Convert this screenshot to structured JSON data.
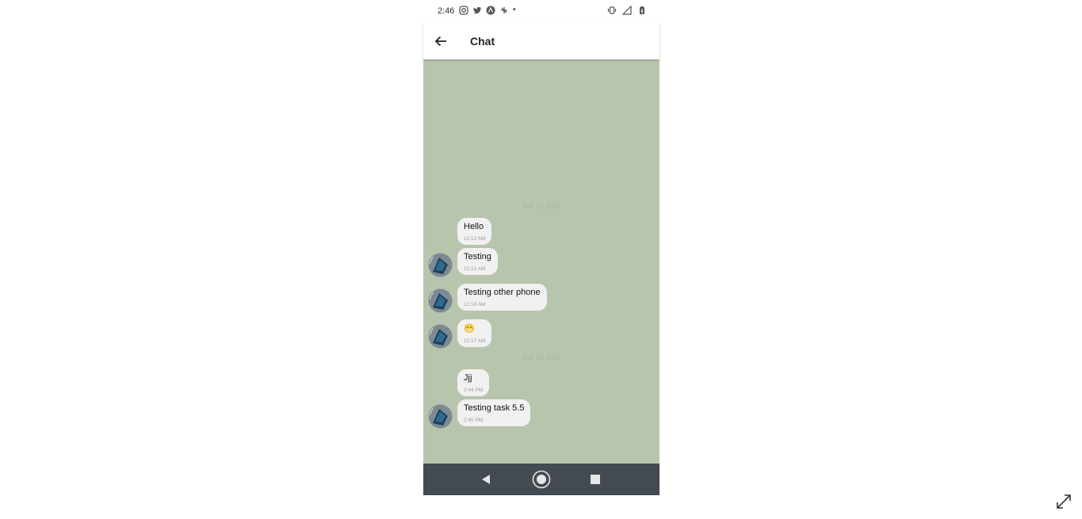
{
  "status_bar": {
    "time": "2:46",
    "left_icons": [
      "instagram-icon",
      "twitter-icon",
      "app-icon",
      "network-icon",
      "more-dot-icon"
    ],
    "right_icons": [
      "vibrate-icon",
      "signal-icon",
      "battery-icon"
    ]
  },
  "app_bar": {
    "title": "Chat",
    "back_icon": "arrow-left-icon"
  },
  "chat": {
    "background_color": "#b8c5ad",
    "date_separators": [
      "Feb 17, 2021",
      "Feb 18, 2021"
    ],
    "messages": [
      {
        "text": "Hello",
        "time": "12:12 AM",
        "avatar": false
      },
      {
        "text": "Testing",
        "time": "12:13 AM",
        "avatar": true
      },
      {
        "text": "Testing other phone",
        "time": "12:16 AM",
        "avatar": true
      },
      {
        "text": "😁",
        "time": "12:17 AM",
        "avatar": true
      },
      {
        "text": "Jjj",
        "time": "2:44 PM",
        "avatar": false
      },
      {
        "text": "Testing task 5.5",
        "time": "2:45 PM",
        "avatar": true
      }
    ]
  },
  "nav_bar": {
    "buttons": [
      "back-triangle-icon",
      "home-circle-icon",
      "recents-square-icon"
    ]
  },
  "window": {
    "expand_icon": "expand-icon"
  }
}
